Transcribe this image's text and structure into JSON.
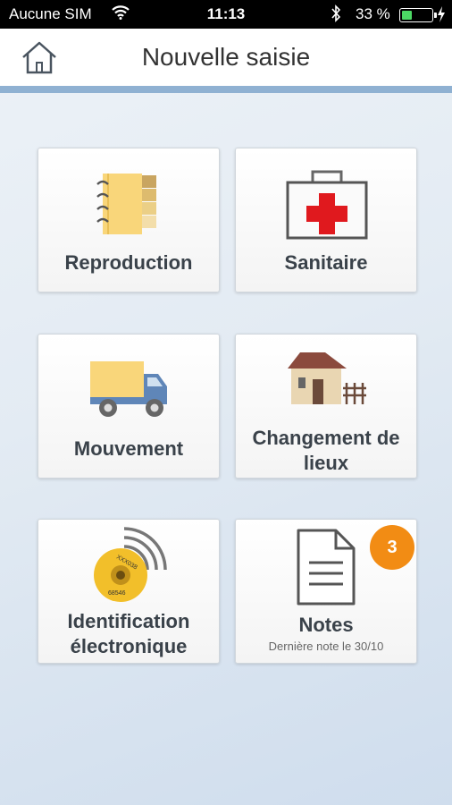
{
  "status_bar": {
    "carrier": "Aucune SIM",
    "time": "11:13",
    "battery_text": "33 %",
    "battery_level": 0.33,
    "wifi_icon": "wifi-icon",
    "bluetooth_icon": "bluetooth-icon",
    "charging_icon": "charging-bolt-icon"
  },
  "nav": {
    "title": "Nouvelle saisie",
    "home_icon": "home-icon"
  },
  "tiles": [
    {
      "label": "Reproduction",
      "icon": "notebook-icon"
    },
    {
      "label": "Sanitaire",
      "icon": "first-aid-kit-icon"
    },
    {
      "label": "Mouvement",
      "icon": "truck-icon"
    },
    {
      "label_line1": "Changement de",
      "label_line2": "lieux",
      "icon": "farm-house-icon"
    },
    {
      "label_line1": "Identification",
      "label_line2": "électronique",
      "icon": "rfid-tag-icon",
      "tag_text_top": "XXX038",
      "tag_text_bottom": "68546"
    },
    {
      "label": "Notes",
      "subtitle": "Dernière note le 30/10",
      "badge": "3",
      "icon": "document-icon"
    }
  ],
  "colors": {
    "accent_blue": "#8fb1d2",
    "badge_orange": "#f28c14",
    "battery_green": "#4cd964",
    "red_cross": "#e0191e",
    "truck_blue": "#5f86b8",
    "notebook_yellow": "#f9d67a"
  }
}
